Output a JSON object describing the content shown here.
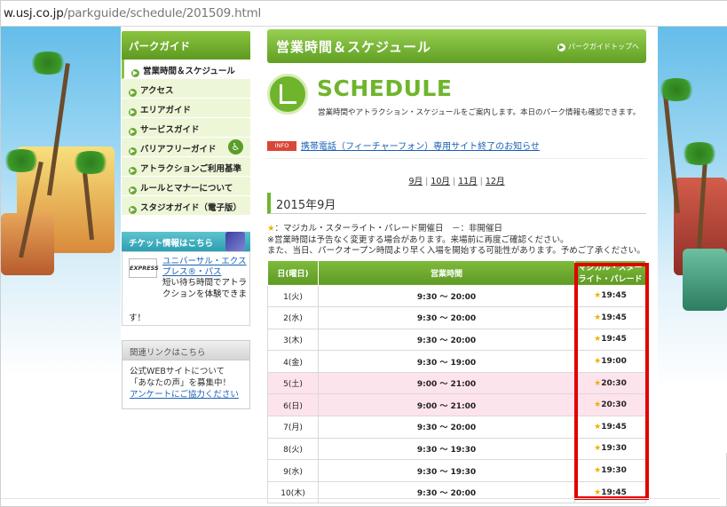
{
  "browser": {
    "url_host": "w.usj.co.jp",
    "url_path": "/parkguide/schedule/201509.html"
  },
  "sidebar": {
    "header": "パークガイド",
    "items": [
      {
        "label": "営業時間＆スケジュール",
        "active": true
      },
      {
        "label": "アクセス"
      },
      {
        "label": "エリアガイド"
      },
      {
        "label": "サービスガイド"
      },
      {
        "label": "バリアフリーガイド"
      },
      {
        "label": "アトラクションご利用基準"
      },
      {
        "label": "ルールとマナーについて"
      },
      {
        "label": "スタジオガイド（電子版）"
      }
    ],
    "ticket": {
      "header": "チケット情報はこちら",
      "logo_text": "EXPRESS",
      "link": "ユニバーサル・エクスプレス®・パス",
      "desc": "短い待ち時間でアトラクションを体験できま",
      "tail": "す！"
    },
    "links": {
      "header": "関連リンクはこちら",
      "line1": "公式WEBサイトについて",
      "line2": "「あなたの声」を募集中！",
      "link": "アンケートにご協力ください"
    }
  },
  "main": {
    "title": "営業時間＆スケジュール",
    "title_link": "パークガイドトップへ",
    "sched_title": "SCHEDULE",
    "sched_desc": "営業時間やアトラクション・スケジュールをご案内します。本日のパーク情報も確認できます。",
    "info_badge": "INFO",
    "info_link": "携帯電話（フィーチャーフォン）専用サイト終了のお知らせ",
    "months": [
      "9月",
      "10月",
      "11月",
      "12月"
    ],
    "month_title": "2015年9月",
    "legend_star": "★",
    "legend_line1": "：マジカル・スターライト・パレード開催日　－：非開催日",
    "legend_line2": "※営業時間は予告なく変更する場合があります。来場前に再度ご確認ください。",
    "legend_line3": "また、当日、パークオープン時間より早く入場を開始する可能性があります。予めご了承ください。",
    "table": {
      "headers": [
        "日(曜日)",
        "営業時間",
        "マジカル・スターライト・パレード"
      ],
      "rows": [
        {
          "day": "1(火)",
          "hours": "9:30 〜 20:00",
          "show": "★19:45",
          "weekend": false
        },
        {
          "day": "2(水)",
          "hours": "9:30 〜 20:00",
          "show": "★19:45",
          "weekend": false
        },
        {
          "day": "3(木)",
          "hours": "9:30 〜 20:00",
          "show": "★19:45",
          "weekend": false
        },
        {
          "day": "4(金)",
          "hours": "9:30 〜 19:00",
          "show": "★19:00",
          "weekend": false
        },
        {
          "day": "5(土)",
          "hours": "9:00 〜 21:00",
          "show": "★20:30",
          "weekend": true
        },
        {
          "day": "6(日)",
          "hours": "9:00 〜 21:00",
          "show": "★20:30",
          "weekend": true
        },
        {
          "day": "7(月)",
          "hours": "9:30 〜 20:00",
          "show": "★19:45",
          "weekend": false
        },
        {
          "day": "8(火)",
          "hours": "9:30 〜 19:30",
          "show": "★19:30",
          "weekend": false
        },
        {
          "day": "9(水)",
          "hours": "9:30 〜 19:30",
          "show": "★19:30",
          "weekend": false
        },
        {
          "day": "10(木)",
          "hours": "9:30 〜 20:00",
          "show": "★19:45",
          "weekend": false
        }
      ]
    }
  },
  "colors": {
    "green": "#6fb52c",
    "link": "#1a5fb4",
    "highlight": "#e00000",
    "weekend_row": "#fde3ec"
  }
}
